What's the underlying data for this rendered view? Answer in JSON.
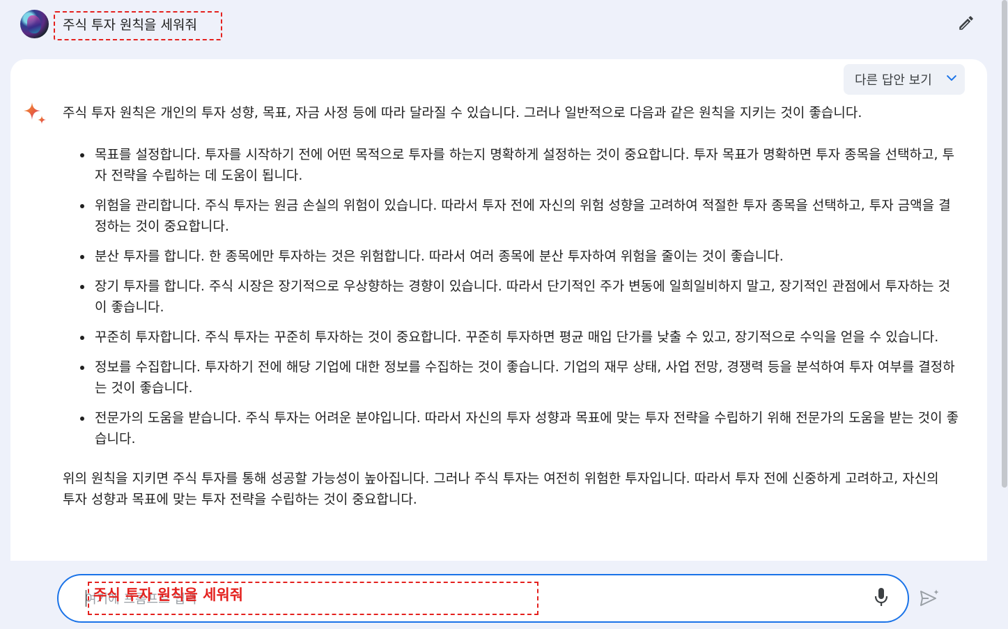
{
  "header": {
    "prompt_title": "주식 투자 원칙을 세워줘"
  },
  "drafts": {
    "label": "다른 답안 보기"
  },
  "response": {
    "intro": "주식 투자 원칙은 개인의 투자 성향, 목표, 자금 사정 등에 따라 달라질 수 있습니다. 그러나 일반적으로 다음과 같은 원칙을 지키는 것이 좋습니다.",
    "items": [
      "목표를 설정합니다. 투자를 시작하기 전에 어떤 목적으로 투자를 하는지 명확하게 설정하는 것이 중요합니다. 투자 목표가 명확하면 투자 종목을 선택하고, 투자 전략을 수립하는 데 도움이 됩니다.",
      "위험을 관리합니다. 주식 투자는 원금 손실의 위험이 있습니다. 따라서 투자 전에 자신의 위험 성향을 고려하여 적절한 투자 종목을 선택하고, 투자 금액을 결정하는 것이 중요합니다.",
      "분산 투자를 합니다. 한 종목에만 투자하는 것은 위험합니다. 따라서 여러 종목에 분산 투자하여 위험을 줄이는 것이 좋습니다.",
      "장기 투자를 합니다. 주식 시장은 장기적으로 우상향하는 경향이 있습니다. 따라서 단기적인 주가 변동에 일희일비하지 말고, 장기적인 관점에서 투자하는 것이 좋습니다.",
      "꾸준히 투자합니다. 주식 투자는 꾸준히 투자하는 것이 중요합니다. 꾸준히 투자하면 평균 매입 단가를 낮출 수 있고, 장기적으로 수익을 얻을 수 있습니다.",
      "정보를 수집합니다. 투자하기 전에 해당 기업에 대한 정보를 수집하는 것이 좋습니다. 기업의 재무 상태, 사업 전망, 경쟁력 등을 분석하여 투자 여부를 결정하는 것이 좋습니다.",
      "전문가의 도움을 받습니다. 주식 투자는 어려운 분야입니다. 따라서 자신의 투자 성향과 목표에 맞는 투자 전략을 수립하기 위해 전문가의 도움을 받는 것이 좋습니다."
    ],
    "outro": "위의 원칙을 지키면 주식 투자를 통해 성공할 가능성이 높아집니다. 그러나 주식 투자는 여전히 위험한 투자입니다. 따라서 투자 전에 신중하게 고려하고, 자신의 투자 성향과 목표에 맞는 투자 전략을 수립하는 것이 중요합니다."
  },
  "input": {
    "placeholder": "여기에 프롬프트 입력",
    "value": "주식 투자 원칙을 세워줘"
  },
  "icons": {
    "edit": "pencil-icon",
    "drafts_toggle": "chevron-down-icon",
    "assistant": "sparkle-icon",
    "mic": "microphone-icon",
    "send": "send-icon"
  },
  "colors": {
    "accent": "#1a73e8",
    "annotation": "#e4211e",
    "background": "#eef1fa"
  }
}
